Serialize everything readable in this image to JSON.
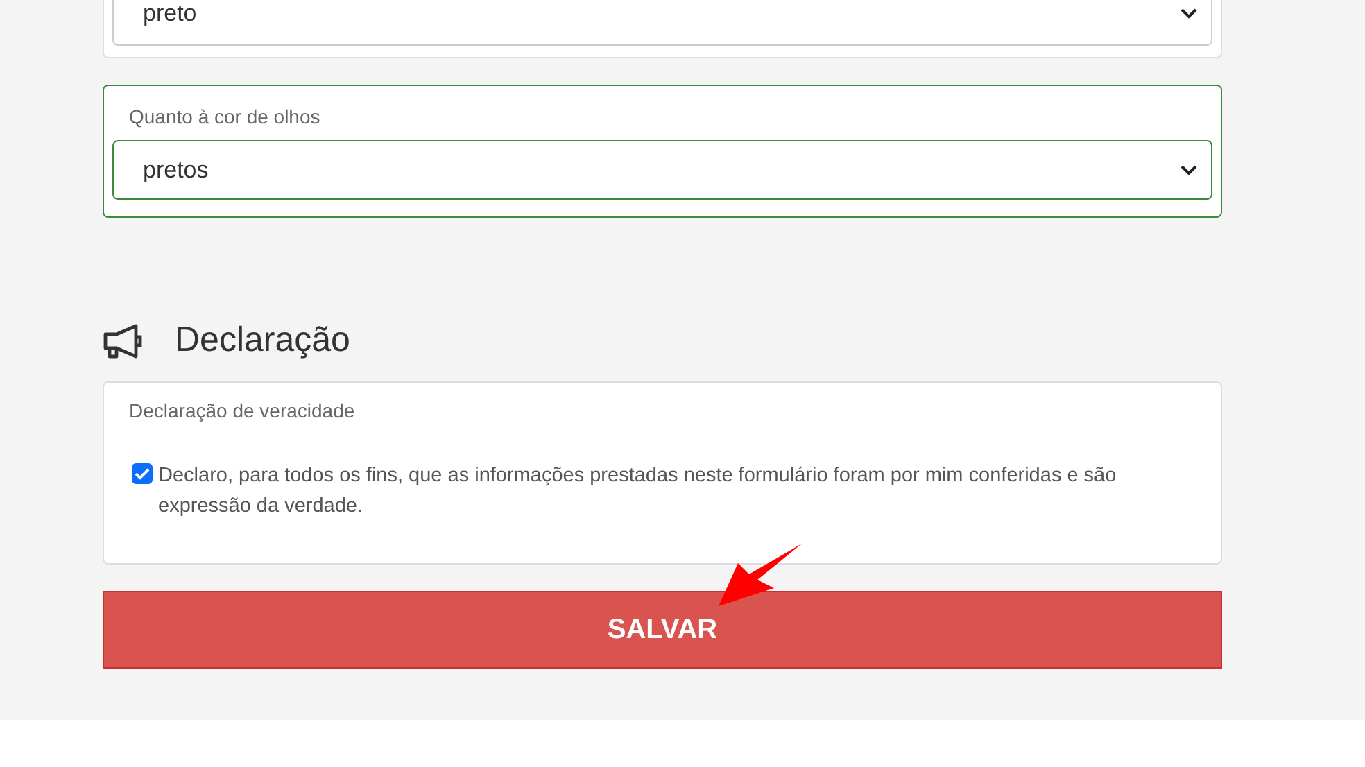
{
  "fields": [
    {
      "value": "preto"
    },
    {
      "label": "Quanto à cor de olhos",
      "value": "pretos"
    }
  ],
  "section": {
    "title": "Declaração"
  },
  "declaration": {
    "label": "Declaração de veracidade",
    "text": "Declaro, para todos os fins, que as informações prestadas neste formulário foram por mim conferidas e são expressão da verdade.",
    "checked": true
  },
  "save_button": "SALVAR"
}
